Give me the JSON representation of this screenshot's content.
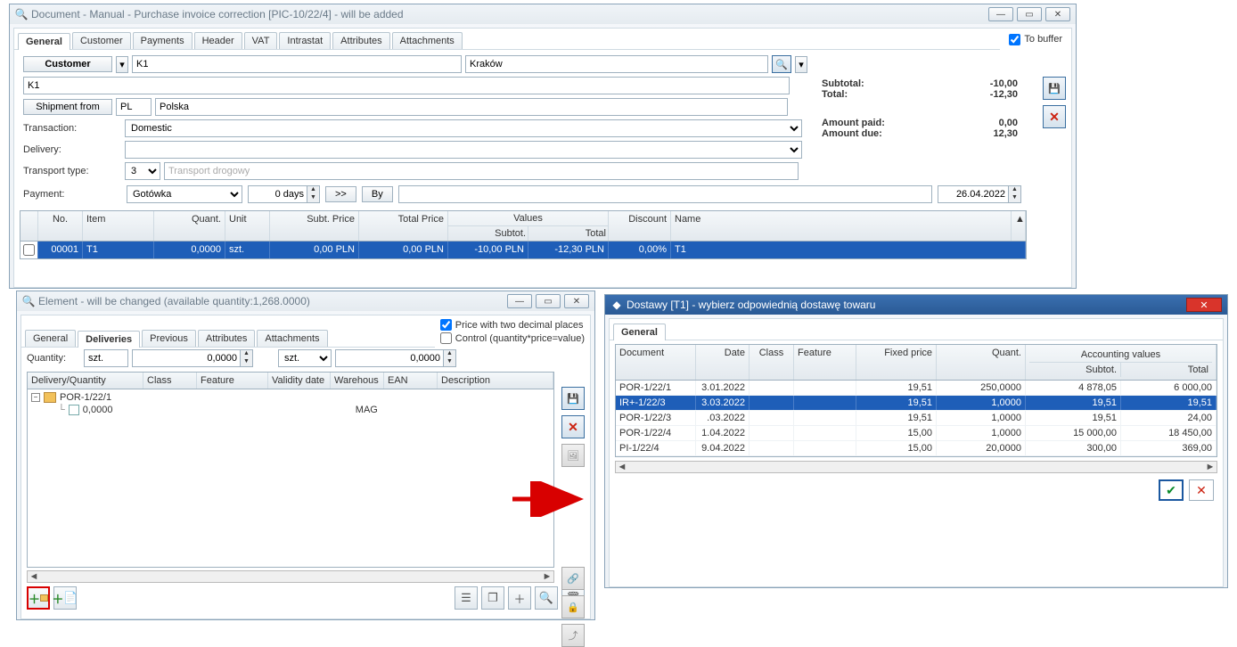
{
  "main": {
    "title": "Document - Manual - Purchase invoice correction [PIC-10/22/4]  - will be added",
    "tabs": [
      "General",
      "Customer",
      "Payments",
      "Header",
      "VAT",
      "Intrastat",
      "Attributes",
      "Attachments"
    ],
    "to_buffer": "To buffer",
    "customer_btn": "Customer",
    "customer_code": "K1",
    "customer_city": "Kraków",
    "customer_full": "K1",
    "shipment_btn": "Shipment from",
    "shipment_code": "PL",
    "shipment_name": "Polska",
    "transaction_lbl": "Transaction:",
    "transaction_val": "Domestic",
    "delivery_lbl": "Delivery:",
    "transport_lbl": "Transport type:",
    "transport_code": "3",
    "transport_name": "Transport drogowy",
    "payment_lbl": "Payment:",
    "payment_method": "Gotówka",
    "payment_days": "0 days",
    "payment_btn_go": ">>",
    "payment_btn_by": "By",
    "payment_date": "26.04.2022",
    "summary": {
      "subtotal_lbl": "Subtotal:",
      "subtotal_val": "-10,00",
      "total_lbl": "Total:",
      "total_val": "-12,30",
      "paid_lbl": "Amount paid:",
      "paid_val": "0,00",
      "due_lbl": "Amount due:",
      "due_val": "12,30"
    },
    "grid": {
      "headers": {
        "no": "No.",
        "item": "Item",
        "quant": "Quant.",
        "unit": "Unit",
        "subt_price": "Subt. Price",
        "total_price": "Total Price",
        "values": "Values",
        "values_sub": "Subtot.",
        "values_tot": "Total",
        "discount": "Discount",
        "name": "Name"
      },
      "row": {
        "no": "00001",
        "item": "T1",
        "quant": "0,0000",
        "unit": "szt.",
        "subt_price": "0,00 PLN",
        "total_price": "0,00 PLN",
        "val_sub": "-10,00 PLN",
        "val_tot": "-12,30 PLN",
        "discount": "0,00%",
        "name": "T1"
      }
    }
  },
  "element": {
    "title": "Element - will be changed (available quantity:1,268.0000)",
    "tabs": [
      "General",
      "Deliveries",
      "Previous",
      "Attributes",
      "Attachments"
    ],
    "opt1": "Price with two decimal places",
    "opt2": "Control (quantity*price=value)",
    "quantity_lbl": "Quantity:",
    "qty_unit1": "szt.",
    "qty_val1": "0,0000",
    "qty_unit2": "szt.",
    "qty_val2": "0,0000",
    "tree_headers": [
      "Delivery/Quantity",
      "Class",
      "Feature",
      "Validity date",
      "Warehous",
      "EAN",
      "Description"
    ],
    "tree": {
      "root": "POR-1/22/1",
      "child_qty": "0,0000",
      "child_wh": "MAG"
    }
  },
  "dostawy": {
    "title": "Dostawy [T1] - wybierz odpowiednią dostawę towaru",
    "tab": "General",
    "headers": {
      "doc": "Document",
      "date": "Date",
      "class": "Class",
      "feature": "Feature",
      "fixed": "Fixed price",
      "quant": "Quant.",
      "acc": "Accounting values",
      "subt": "Subtot.",
      "total": "Total"
    },
    "rows": [
      {
        "doc": "POR-1/22/1",
        "date": "3.01.2022",
        "fixed": "19,51",
        "quant": "250,0000",
        "subt": "4 878,05",
        "total": "6 000,00"
      },
      {
        "doc": "IR+-1/22/3",
        "date": "3.03.2022",
        "fixed": "19,51",
        "quant": "1,0000",
        "subt": "19,51",
        "total": "19,51"
      },
      {
        "doc": "POR-1/22/3",
        "date": ".03.2022",
        "fixed": "19,51",
        "quant": "1,0000",
        "subt": "19,51",
        "total": "24,00"
      },
      {
        "doc": "POR-1/22/4",
        "date": "1.04.2022",
        "fixed": "15,00",
        "quant": "1,0000",
        "subt": "15 000,00",
        "total": "18 450,00"
      },
      {
        "doc": "PI-1/22/4",
        "date": "9.04.2022",
        "fixed": "15,00",
        "quant": "20,0000",
        "subt": "300,00",
        "total": "369,00"
      }
    ]
  }
}
